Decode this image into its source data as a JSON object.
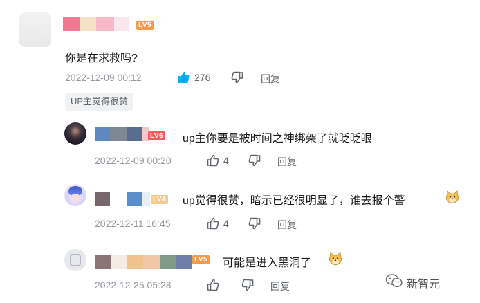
{
  "main_comment": {
    "text": "你是在求救吗?",
    "timestamp": "2022-12-09 00:12",
    "likes": "276",
    "reply_label": "回复",
    "level": "LV5",
    "tag": "UP主觉得很赞"
  },
  "replies": [
    {
      "text": "up主你要是被时间之神绑架了就眨眨眼",
      "timestamp": "2022-12-09 00:20",
      "likes": "4",
      "reply_label": "回复",
      "level": "LV6"
    },
    {
      "text": "up觉得很赞，暗示已经很明显了，谁去报个警",
      "timestamp": "2022-12-11 16:45",
      "likes": "4",
      "reply_label": "回复",
      "level": "LV4",
      "emoji": "doge-emoji"
    },
    {
      "text": "可能是进入黑洞了",
      "timestamp": "2022-12-25 05:28",
      "likes": "",
      "reply_label": "回复",
      "level": "LV5",
      "emoji": "doge-emoji"
    }
  ],
  "watermark": {
    "label": "新智元",
    "icon": "wechat-icon"
  },
  "colors": {
    "like_active": "#00aeec",
    "meta_gray": "#9499a0",
    "action_gray": "#61666d",
    "text": "#18191c"
  }
}
